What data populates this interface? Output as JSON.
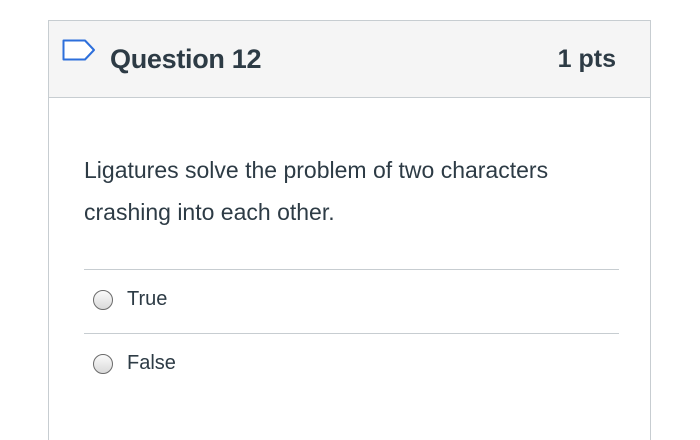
{
  "question": {
    "title": "Question 12",
    "points": "1 pts",
    "flag_icon": "bookmark-flag-icon",
    "text": "Ligatures solve the problem of two characters crashing into each other."
  },
  "answers": [
    {
      "label": "True",
      "selected": false
    },
    {
      "label": "False",
      "selected": false
    }
  ],
  "colors": {
    "text": "#2d3b45",
    "header_bg": "#f5f5f5",
    "border": "#c7cdd1",
    "flag": "#2d6fdb"
  }
}
